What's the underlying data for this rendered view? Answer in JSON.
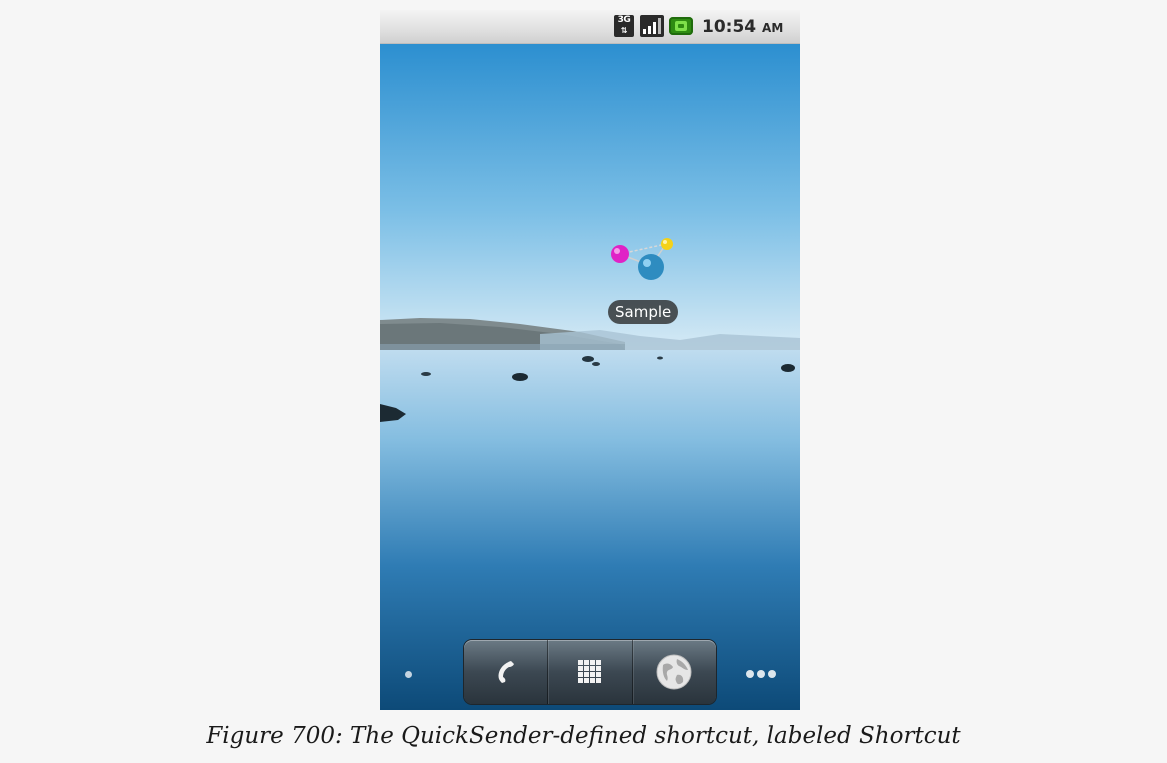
{
  "status_bar": {
    "network_type": "3G",
    "time": "10:54",
    "ampm": "AM"
  },
  "home": {
    "shortcut": {
      "label": "Sample",
      "icon": "molecule-icon"
    },
    "dock": [
      {
        "name": "phone",
        "icon": "phone-icon"
      },
      {
        "name": "launcher",
        "icon": "grid-icon"
      },
      {
        "name": "browser",
        "icon": "globe-icon"
      }
    ]
  },
  "caption": "Figure 700: The QuickSender-defined shortcut, labeled Shortcut",
  "colors": {
    "sky_top": "#2c8fd0",
    "sky_horizon": "#d6eaf5",
    "water_deep": "#0d4a78",
    "molecule_magenta": "#e022c6",
    "molecule_yellow": "#f4d21a",
    "molecule_blue": "#2e8cc0"
  }
}
